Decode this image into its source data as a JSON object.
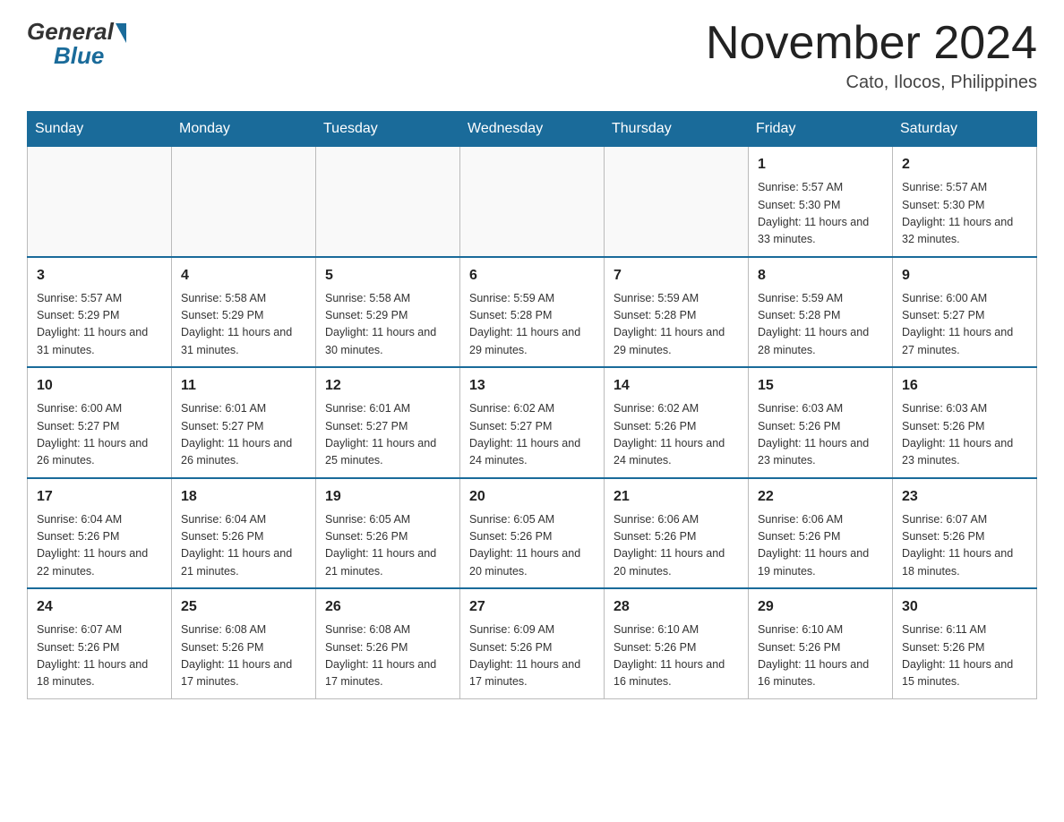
{
  "header": {
    "logo": {
      "general": "General",
      "blue": "Blue"
    },
    "title": "November 2024",
    "location": "Cato, Ilocos, Philippines"
  },
  "weekdays": [
    "Sunday",
    "Monday",
    "Tuesday",
    "Wednesday",
    "Thursday",
    "Friday",
    "Saturday"
  ],
  "weeks": [
    [
      {
        "day": "",
        "info": ""
      },
      {
        "day": "",
        "info": ""
      },
      {
        "day": "",
        "info": ""
      },
      {
        "day": "",
        "info": ""
      },
      {
        "day": "",
        "info": ""
      },
      {
        "day": "1",
        "info": "Sunrise: 5:57 AM\nSunset: 5:30 PM\nDaylight: 11 hours and 33 minutes."
      },
      {
        "day": "2",
        "info": "Sunrise: 5:57 AM\nSunset: 5:30 PM\nDaylight: 11 hours and 32 minutes."
      }
    ],
    [
      {
        "day": "3",
        "info": "Sunrise: 5:57 AM\nSunset: 5:29 PM\nDaylight: 11 hours and 31 minutes."
      },
      {
        "day": "4",
        "info": "Sunrise: 5:58 AM\nSunset: 5:29 PM\nDaylight: 11 hours and 31 minutes."
      },
      {
        "day": "5",
        "info": "Sunrise: 5:58 AM\nSunset: 5:29 PM\nDaylight: 11 hours and 30 minutes."
      },
      {
        "day": "6",
        "info": "Sunrise: 5:59 AM\nSunset: 5:28 PM\nDaylight: 11 hours and 29 minutes."
      },
      {
        "day": "7",
        "info": "Sunrise: 5:59 AM\nSunset: 5:28 PM\nDaylight: 11 hours and 29 minutes."
      },
      {
        "day": "8",
        "info": "Sunrise: 5:59 AM\nSunset: 5:28 PM\nDaylight: 11 hours and 28 minutes."
      },
      {
        "day": "9",
        "info": "Sunrise: 6:00 AM\nSunset: 5:27 PM\nDaylight: 11 hours and 27 minutes."
      }
    ],
    [
      {
        "day": "10",
        "info": "Sunrise: 6:00 AM\nSunset: 5:27 PM\nDaylight: 11 hours and 26 minutes."
      },
      {
        "day": "11",
        "info": "Sunrise: 6:01 AM\nSunset: 5:27 PM\nDaylight: 11 hours and 26 minutes."
      },
      {
        "day": "12",
        "info": "Sunrise: 6:01 AM\nSunset: 5:27 PM\nDaylight: 11 hours and 25 minutes."
      },
      {
        "day": "13",
        "info": "Sunrise: 6:02 AM\nSunset: 5:27 PM\nDaylight: 11 hours and 24 minutes."
      },
      {
        "day": "14",
        "info": "Sunrise: 6:02 AM\nSunset: 5:26 PM\nDaylight: 11 hours and 24 minutes."
      },
      {
        "day": "15",
        "info": "Sunrise: 6:03 AM\nSunset: 5:26 PM\nDaylight: 11 hours and 23 minutes."
      },
      {
        "day": "16",
        "info": "Sunrise: 6:03 AM\nSunset: 5:26 PM\nDaylight: 11 hours and 23 minutes."
      }
    ],
    [
      {
        "day": "17",
        "info": "Sunrise: 6:04 AM\nSunset: 5:26 PM\nDaylight: 11 hours and 22 minutes."
      },
      {
        "day": "18",
        "info": "Sunrise: 6:04 AM\nSunset: 5:26 PM\nDaylight: 11 hours and 21 minutes."
      },
      {
        "day": "19",
        "info": "Sunrise: 6:05 AM\nSunset: 5:26 PM\nDaylight: 11 hours and 21 minutes."
      },
      {
        "day": "20",
        "info": "Sunrise: 6:05 AM\nSunset: 5:26 PM\nDaylight: 11 hours and 20 minutes."
      },
      {
        "day": "21",
        "info": "Sunrise: 6:06 AM\nSunset: 5:26 PM\nDaylight: 11 hours and 20 minutes."
      },
      {
        "day": "22",
        "info": "Sunrise: 6:06 AM\nSunset: 5:26 PM\nDaylight: 11 hours and 19 minutes."
      },
      {
        "day": "23",
        "info": "Sunrise: 6:07 AM\nSunset: 5:26 PM\nDaylight: 11 hours and 18 minutes."
      }
    ],
    [
      {
        "day": "24",
        "info": "Sunrise: 6:07 AM\nSunset: 5:26 PM\nDaylight: 11 hours and 18 minutes."
      },
      {
        "day": "25",
        "info": "Sunrise: 6:08 AM\nSunset: 5:26 PM\nDaylight: 11 hours and 17 minutes."
      },
      {
        "day": "26",
        "info": "Sunrise: 6:08 AM\nSunset: 5:26 PM\nDaylight: 11 hours and 17 minutes."
      },
      {
        "day": "27",
        "info": "Sunrise: 6:09 AM\nSunset: 5:26 PM\nDaylight: 11 hours and 17 minutes."
      },
      {
        "day": "28",
        "info": "Sunrise: 6:10 AM\nSunset: 5:26 PM\nDaylight: 11 hours and 16 minutes."
      },
      {
        "day": "29",
        "info": "Sunrise: 6:10 AM\nSunset: 5:26 PM\nDaylight: 11 hours and 16 minutes."
      },
      {
        "day": "30",
        "info": "Sunrise: 6:11 AM\nSunset: 5:26 PM\nDaylight: 11 hours and 15 minutes."
      }
    ]
  ]
}
